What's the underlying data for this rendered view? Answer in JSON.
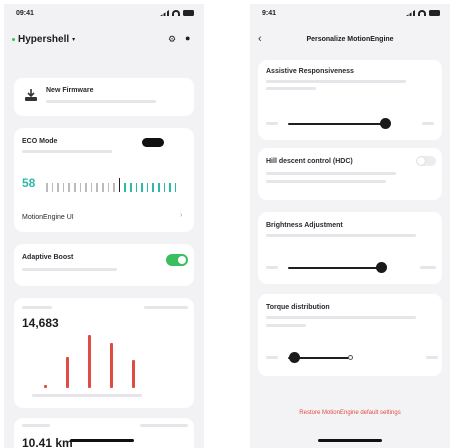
{
  "left": {
    "status_time": "09:41",
    "app_title": "Hypershell",
    "firmware_title": "New Firmware",
    "eco_title": "ECO Mode",
    "eco_level": "58",
    "motion_engine": "MotionEngine UI",
    "adaptive_title": "Adaptive Boost",
    "stats_value": "14,683",
    "bars": [
      0.05,
      0.55,
      0.95,
      0.8,
      0.5
    ],
    "distance_value": "10.41 km"
  },
  "right": {
    "status_time": "9:41",
    "header_title": "Personalize MotionEngine",
    "assistive_title": "Assistive Responsiveness",
    "assistive_level": 0.78,
    "hill_title": "Hill descent control (HDC)",
    "brightness_title": "Brightness Adjustment",
    "brightness_level": 0.75,
    "torque_title": "Torque distribution",
    "torque_level": 0.05,
    "restore_label": "Restore MotionEngine default settings"
  },
  "colors": {
    "accent_red": "#e24b42",
    "toggle_green": "#3bbf5e",
    "eco_teal": "#2fb8a8"
  }
}
